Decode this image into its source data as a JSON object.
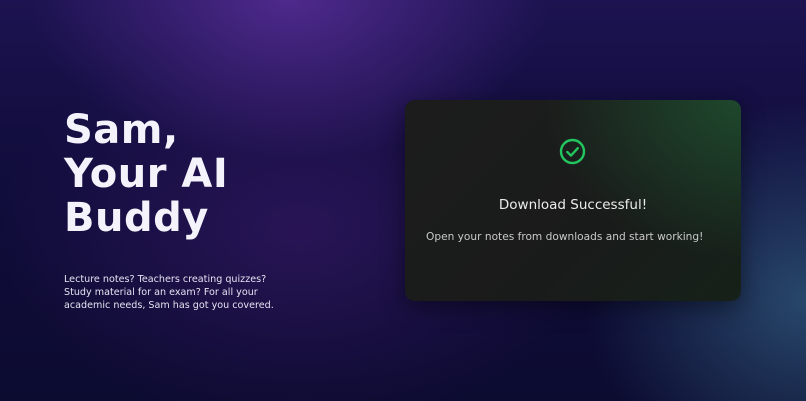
{
  "hero": {
    "title_lines": [
      "Sam,",
      "Your AI",
      "Buddy"
    ],
    "description": "Lecture notes? Teachers creating quizzes? Study material for an exam? For all your academic needs, Sam has got you covered."
  },
  "modal": {
    "icon": "check-circle-icon",
    "title": "Download Successful!",
    "message": "Open your notes from downloads and start working!",
    "accent_color": "#22c55e"
  }
}
